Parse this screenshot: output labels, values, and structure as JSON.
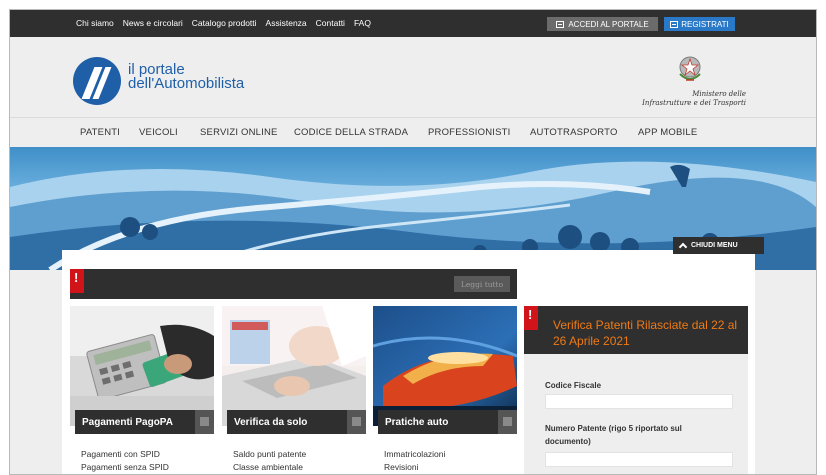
{
  "top_links": [
    "Chi siamo",
    "News e circolari",
    "Catalogo prodotti",
    "Assistenza",
    "Contatti",
    "FAQ"
  ],
  "top_buttons": {
    "accedi": "ACCEDI AL PORTALE",
    "registrati": "REGISTRATI"
  },
  "logo": {
    "line1": "il portale",
    "line2": "dell'Automobilista"
  },
  "ministry": {
    "line1": "Ministero delle",
    "line2": "Infrastrutture e dei Trasporti"
  },
  "nav": [
    "PATENTI",
    "VEICOLI",
    "SERVIZI ONLINE",
    "CODICE DELLA STRADA",
    "PROFESSIONISTI",
    "AUTOTRASPORTO",
    "APP MOBILE"
  ],
  "hero": {
    "close_menu": "CHIUDI MENU"
  },
  "news": {
    "flag": "!",
    "read_all": "Leggi tutto"
  },
  "cards": [
    {
      "title": "Pagamenti PagoPA",
      "links": [
        "Pagamenti con SPID",
        "Pagamenti senza SPID"
      ]
    },
    {
      "title": "Verifica da solo",
      "links": [
        "Saldo punti patente",
        "Classe ambientale"
      ]
    },
    {
      "title": "Pratiche auto",
      "links": [
        "Immatricolazioni",
        "Revisioni"
      ]
    }
  ],
  "verify": {
    "flag": "!",
    "title": "Verifica Patenti Rilasciate dal 22 al 26 Aprile 2021",
    "field1_label": "Codice Fiscale",
    "field2_label": "Numero Patente (rigo 5 riportato sul documento)"
  },
  "colors": {
    "dark_bar": "#2f2f2f",
    "brand_blue": "#1f5fa8",
    "register_blue": "#2a79c9",
    "alert_red": "#d0141a",
    "orange_title": "#f07a14"
  }
}
